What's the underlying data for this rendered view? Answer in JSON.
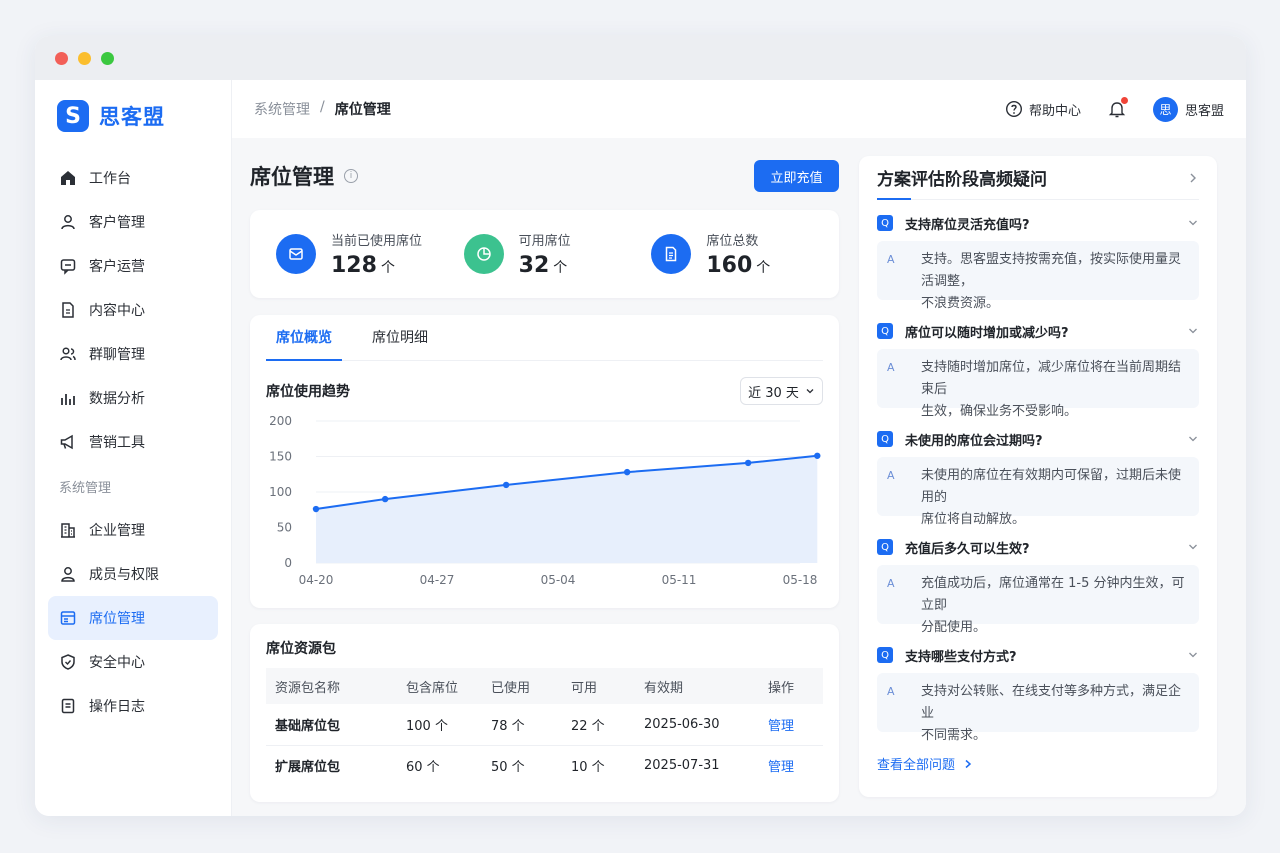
{
  "window": {
    "dots": [
      "#f25f58",
      "#fbbe2e",
      "#3bc840"
    ]
  },
  "brand": {
    "mark": "S",
    "name": "思客盟"
  },
  "sidebar": {
    "items": [
      {
        "label": "工作台",
        "icon": "home-icon"
      },
      {
        "label": "客户管理",
        "icon": "user-icon"
      },
      {
        "label": "客户运营",
        "icon": "chat-icon"
      },
      {
        "label": "内容中心",
        "icon": "document-icon"
      },
      {
        "label": "群聊管理",
        "icon": "group-icon"
      },
      {
        "label": "数据分析",
        "icon": "bar-chart-icon"
      },
      {
        "label": "营销工具",
        "icon": "megaphone-icon"
      }
    ],
    "section_label": "系统管理",
    "system_items": [
      {
        "label": "企业管理",
        "icon": "building-icon"
      },
      {
        "label": "成员与权限",
        "icon": "member-icon"
      },
      {
        "label": "席位管理",
        "icon": "seat-icon",
        "active": true
      },
      {
        "label": "安全中心",
        "icon": "shield-icon"
      },
      {
        "label": "操作日志",
        "icon": "log-icon"
      }
    ]
  },
  "topbar": {
    "breadcrumb": [
      "系统管理",
      "/",
      "席位管理"
    ],
    "help": "帮助中心",
    "user_avatar": "思",
    "user_name": "思客盟"
  },
  "page": {
    "title": "席位管理",
    "recharge_button": "立即充值"
  },
  "stats": [
    {
      "label": "当前已使用席位",
      "value": "128",
      "unit": "个",
      "color": "#1c6cf2",
      "icon": "mail-icon"
    },
    {
      "label": "可用席位",
      "value": "32",
      "unit": "个",
      "color": "#3cc28f",
      "icon": "pie-icon"
    },
    {
      "label": "席位总数",
      "value": "160",
      "unit": "个",
      "color": "#1c6cf2",
      "icon": "file-icon"
    }
  ],
  "tabs": [
    "席位概览",
    "席位明细"
  ],
  "chart": {
    "title": "席位使用趋势",
    "range_select": "近 30 天"
  },
  "chart_data": {
    "type": "area",
    "title": "席位使用趋势",
    "x": [
      "04-20",
      "04-24",
      "05-01",
      "05-08",
      "05-15",
      "05-19"
    ],
    "x_ticks": [
      "04-20",
      "04-27",
      "05-04",
      "05-11",
      "05-18"
    ],
    "values": [
      76,
      90,
      110,
      128,
      141,
      151
    ],
    "ylim": [
      0,
      200
    ],
    "y_ticks": [
      "0",
      "50",
      "100",
      "150",
      "200"
    ],
    "grid": true,
    "color": "#1c6cf2"
  },
  "resources": {
    "title": "席位资源包",
    "columns": [
      "资源包名称",
      "包含席位",
      "已使用",
      "可用",
      "有效期",
      "操作"
    ],
    "rows": [
      [
        "基础席位包",
        "100 个",
        "78 个",
        "22 个",
        "2025-06-30",
        "管理"
      ],
      [
        "扩展席位包",
        "60 个",
        "50 个",
        "10 个",
        "2025-07-31",
        "管理"
      ]
    ]
  },
  "faq": {
    "title": "方案评估阶段高频疑问",
    "q_tag": "Q",
    "a_tag": "A",
    "items": [
      {
        "q": "支持席位灵活充值吗?",
        "a1": "支持。思客盟支持按需充值，按实际使用量灵活调整，",
        "a2": "不浪费资源。"
      },
      {
        "q": "席位可以随时增加或减少吗?",
        "a1": "支持随时增加席位，减少席位将在当前周期结束后",
        "a2": "生效，确保业务不受影响。"
      },
      {
        "q": "未使用的席位会过期吗?",
        "a1": "未使用的席位在有效期内可保留，过期后未使用的",
        "a2": "席位将自动解放。"
      },
      {
        "q": "充值后多久可以生效?",
        "a1": "充值成功后，席位通常在 1-5 分钟内生效，可立即",
        "a2": "分配使用。"
      },
      {
        "q": "支持哪些支付方式?",
        "a1": "支持对公转账、在线支付等多种方式，满足企业",
        "a2": "不同需求。"
      }
    ],
    "view_all": "查看全部问题"
  }
}
